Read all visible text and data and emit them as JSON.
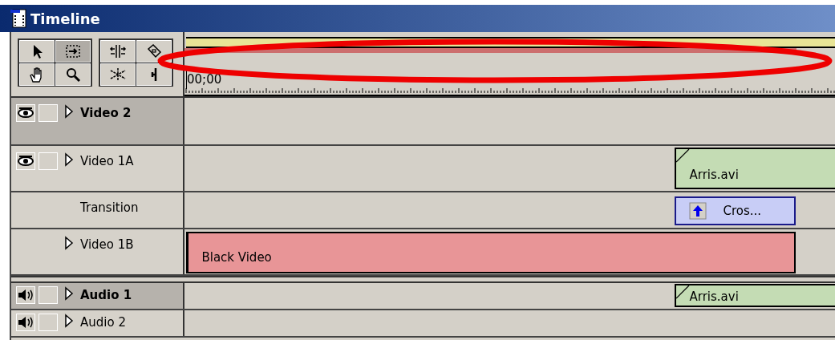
{
  "window": {
    "title": "Timeline"
  },
  "ruler": {
    "labels": [
      "00;00"
    ]
  },
  "tools": [
    {
      "kind": "select",
      "selected": false
    },
    {
      "kind": "range",
      "selected": true
    },
    {
      "kind": "ripple",
      "selected": false
    },
    {
      "kind": "razor",
      "selected": false
    },
    {
      "kind": "hand",
      "selected": false
    },
    {
      "kind": "zoom",
      "selected": false
    },
    {
      "kind": "fade",
      "selected": false
    },
    {
      "kind": "inpoint",
      "selected": false
    }
  ],
  "tracks": [
    {
      "name": "Video 2",
      "kind": "video",
      "selected": true
    },
    {
      "name": "Video 1A",
      "kind": "video",
      "selected": false,
      "clips": [
        {
          "name": "Arris.avi",
          "kind": "video"
        }
      ]
    },
    {
      "name": "Transition",
      "kind": "transition",
      "selected": false,
      "clips": [
        {
          "name": "Cros...",
          "kind": "transition"
        }
      ]
    },
    {
      "name": "Video 1B",
      "kind": "subtrack",
      "selected": false,
      "clips": [
        {
          "name": "Black Video",
          "kind": "matte"
        }
      ]
    },
    {
      "name": "Audio 1",
      "kind": "audio",
      "selected": true,
      "clips": [
        {
          "name": "Arris.avi",
          "kind": "audio"
        }
      ]
    },
    {
      "name": "Audio 2",
      "kind": "audio",
      "selected": false
    }
  ]
}
